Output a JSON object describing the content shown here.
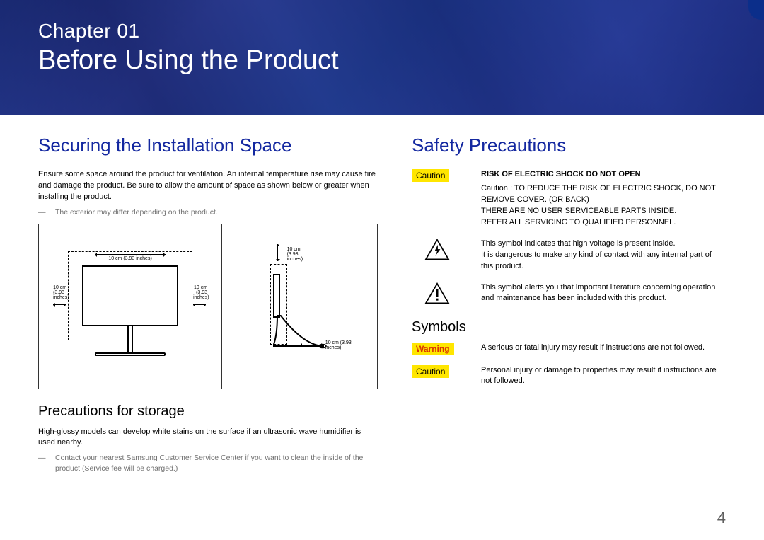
{
  "banner": {
    "chapter_label": "Chapter  01",
    "title": "Before Using the Product"
  },
  "left": {
    "section_title": "Securing the Installation Space",
    "intro": "Ensure some space around the product for ventilation. An internal temperature rise may cause fire and damage the product. Be sure to allow the amount of space as shown below or greater when installing the product.",
    "note1": "The exterior may differ depending on the product.",
    "diagram": {
      "dim_top": "10 cm (3.93 inches)",
      "dim_left": "10 cm\n(3.93 inches)",
      "dim_right": "10 cm\n(3.93 inches)",
      "side_dim_top": "10 cm\n(3.93 inches)",
      "side_dim_bottom": "10 cm (3.93 inches)"
    },
    "subsection_title": "Precautions for storage",
    "storage_body": "High-glossy models can develop white stains on the surface if an ultrasonic wave humidifier is used nearby.",
    "storage_note": "Contact your nearest Samsung Customer Service Center if you want to clean the inside of the product (Service fee will be charged.)"
  },
  "right": {
    "section_title": "Safety Precautions",
    "caution_label": "Caution",
    "risk_title": "RISK OF ELECTRIC SHOCK DO NOT OPEN",
    "risk_body": "Caution : TO REDUCE THE RISK OF ELECTRIC SHOCK, DO NOT REMOVE COVER. (OR BACK)\nTHERE ARE NO USER SERVICEABLE PARTS INSIDE.\nREFER ALL SERVICING TO QUALIFIED PERSONNEL.",
    "lightning_text": "This symbol indicates that high voltage is present inside.\nIt is dangerous to make any kind of contact with any internal part of this product.",
    "exclaim_text": "This symbol alerts you that important literature concerning operation and maintenance has been included with this product.",
    "symbols_title": "Symbols",
    "warning_label": "Warning",
    "warning_text": "A serious or fatal injury may result if instructions are not followed.",
    "caution2_label": "Caution",
    "caution_text": "Personal injury or damage to properties may result if instructions are not followed."
  },
  "page_number": "4"
}
